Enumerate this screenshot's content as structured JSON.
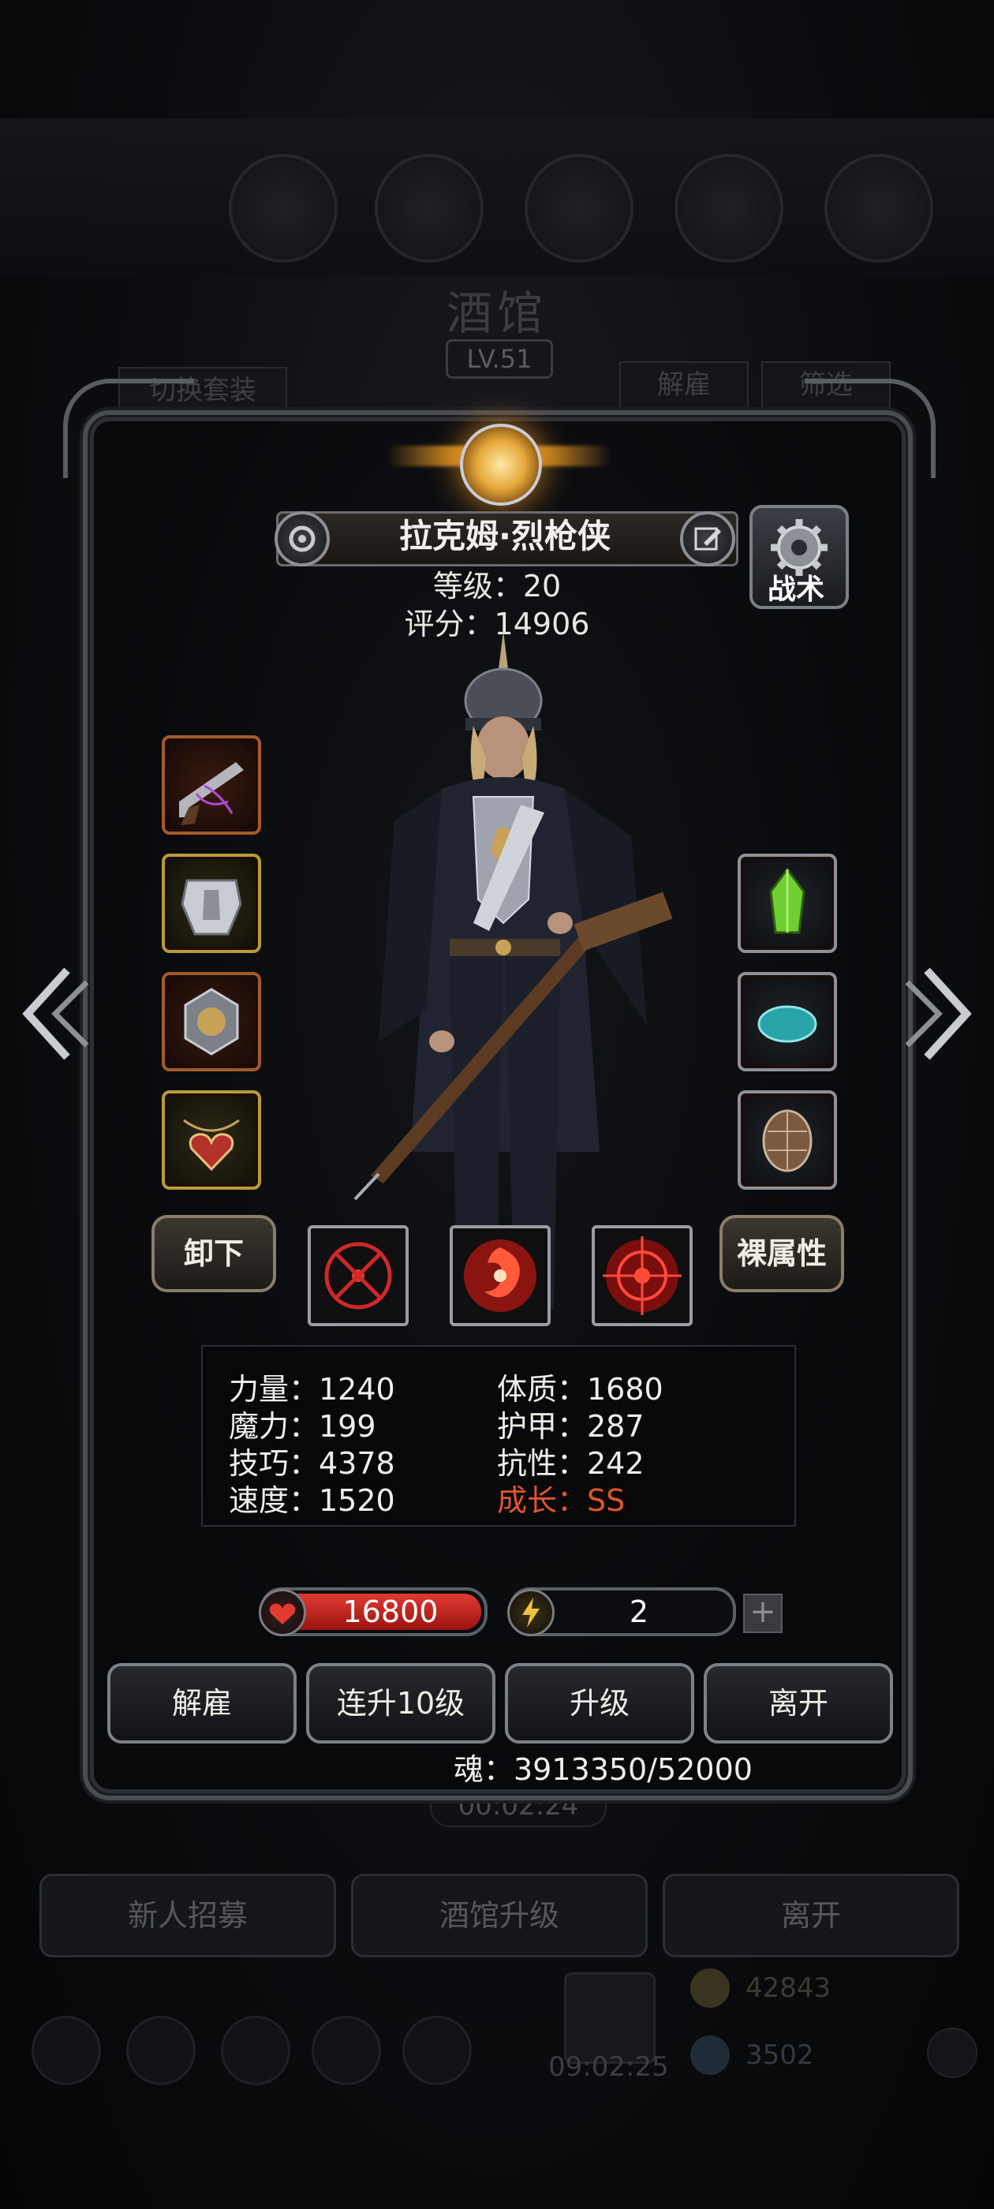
{
  "background": {
    "title": "酒馆",
    "level": "LV.51",
    "tab_switch_set": "切换套装",
    "tab_dismiss": "解雇",
    "tab_filter": "筛选",
    "timer": "00:02:24",
    "bottom_buttons": [
      "新人招募",
      "酒馆升级",
      "离开"
    ],
    "gold": "42843",
    "stones": "3502",
    "gift_timer": "09:02:25"
  },
  "hero": {
    "name": "拉克姆·烈枪侠",
    "level_label": "等级：20",
    "score_label": "评分：14906",
    "tactic_label": "战术"
  },
  "equipment_left": [
    {
      "name": "flintlock-pistol-icon"
    },
    {
      "name": "armor-icon"
    },
    {
      "name": "emblem-amulet-icon"
    },
    {
      "name": "heart-necklace-icon"
    }
  ],
  "equipment_right": [
    {
      "name": "green-crystal-icon"
    },
    {
      "name": "teal-gem-icon"
    },
    {
      "name": "turtle-shell-icon"
    }
  ],
  "unequip_label": "卸下",
  "base_attr_label": "裸属性",
  "stats": {
    "strength": "力量：1240",
    "magic": "魔力：199",
    "skill": "技巧：4378",
    "speed": "速度：1520",
    "constitution": "体质：1680",
    "armor": "护甲：287",
    "resistance": "抗性：242",
    "growth": "成长：SS"
  },
  "hp_value": "16800",
  "energy_value": "2",
  "plus_label": "+",
  "actions": [
    "解雇",
    "连升10级",
    "升级",
    "离开"
  ],
  "soul_label": "魂：3913350/52000",
  "colors": {
    "growth": "#e0542a",
    "hp": "#d8332b",
    "gold_emblem": "#e6a83a"
  }
}
